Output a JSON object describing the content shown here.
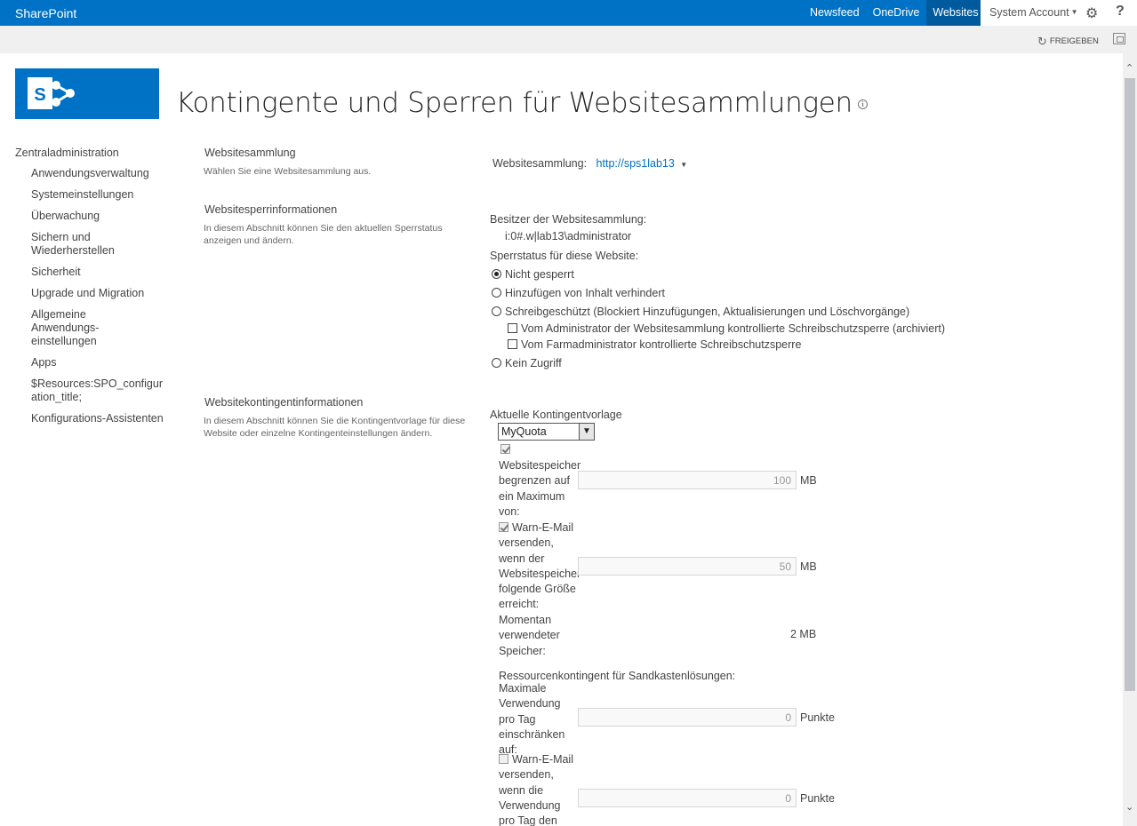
{
  "suitebar": {
    "brand": "SharePoint",
    "links": [
      "Newsfeed",
      "OneDrive",
      "Websites"
    ],
    "active_link": "Websites",
    "account": "System Account",
    "gear_icon": "gear-icon",
    "help_icon": "help-icon",
    "help_label": "?",
    "brand_color": "#0072c6"
  },
  "ribbon": {
    "share_label": "FREIGEBEN",
    "focus_icon": "focus-mode-icon"
  },
  "page": {
    "title": "Kontingente und Sperren für Websitesammlungen"
  },
  "nav": {
    "root": "Zentraladministration",
    "items": [
      "Anwendungsverwaltung",
      "Systemeinstellungen",
      "Überwachung",
      "Sichern und Wiederherstellen",
      "Sicherheit",
      "Upgrade und Migration",
      "Allgemeine Anwendungs-einstellungen",
      "Apps",
      "$Resources:SPO_configuration_title;",
      "Konfigurations-Assistenten"
    ]
  },
  "sections": {
    "collection": {
      "title": "Websitesammlung",
      "desc": "Wählen Sie eine Websitesammlung aus.",
      "label": "Websitesammlung:",
      "value": "http://sps1lab13"
    },
    "lock": {
      "title": "Websitesperrinformationen",
      "desc": "In diesem Abschnitt können Sie den aktuellen Sperrstatus anzeigen und ändern.",
      "owner_label": "Besitzer der Websitesammlung:",
      "owner_value": "i:0#.w|lab13\\administrator",
      "status_label": "Sperrstatus für diese Website:",
      "options": {
        "not_locked": "Nicht gesperrt",
        "no_additions": "Hinzufügen von Inhalt verhindert",
        "read_only": "Schreibgeschützt (Blockiert Hinzufügungen, Aktualisierungen und Löschvorgänge)",
        "read_only_admin": "Vom Administrator der Websitesammlung kontrollierte Schreibschutzsperre (archiviert)",
        "read_only_farm": "Vom Farmadministrator kontrollierte Schreibschutzsperre",
        "no_access": "Kein Zugriff"
      },
      "selected": "not_locked"
    },
    "quota": {
      "title": "Websitekontingentinformationen",
      "desc": "In diesem Abschnitt können Sie die Kontingentvorlage für diese Website oder einzelne Kontingenteinstellungen ändern.",
      "template_label": "Aktuelle Kontingentvorlage",
      "template_value": "MyQuota",
      "limit_label": "Websitespeicher begrenzen auf ein Maximum von:",
      "limit_value": "100",
      "limit_unit": "MB",
      "warn_label": "Warn-E-Mail versenden, wenn der Websitespeicher folgende Größe erreicht:",
      "warn_value": "50",
      "warn_unit": "MB",
      "used_label": "Momentan verwendeter Speicher:",
      "used_value": "2 MB",
      "sandbox_label": "Ressourcenkontingent für Sandkastenlösungen:",
      "sandbox_max_label": "Maximale Verwendung pro Tag einschränken auf:",
      "sandbox_max_value": "0",
      "sandbox_max_unit": "Punkte",
      "sandbox_warn_label": "Warn-E-Mail versenden, wenn die Verwendung pro Tag den folgenden Wert",
      "sandbox_warn_value": "0",
      "sandbox_warn_unit": "Punkte"
    }
  }
}
